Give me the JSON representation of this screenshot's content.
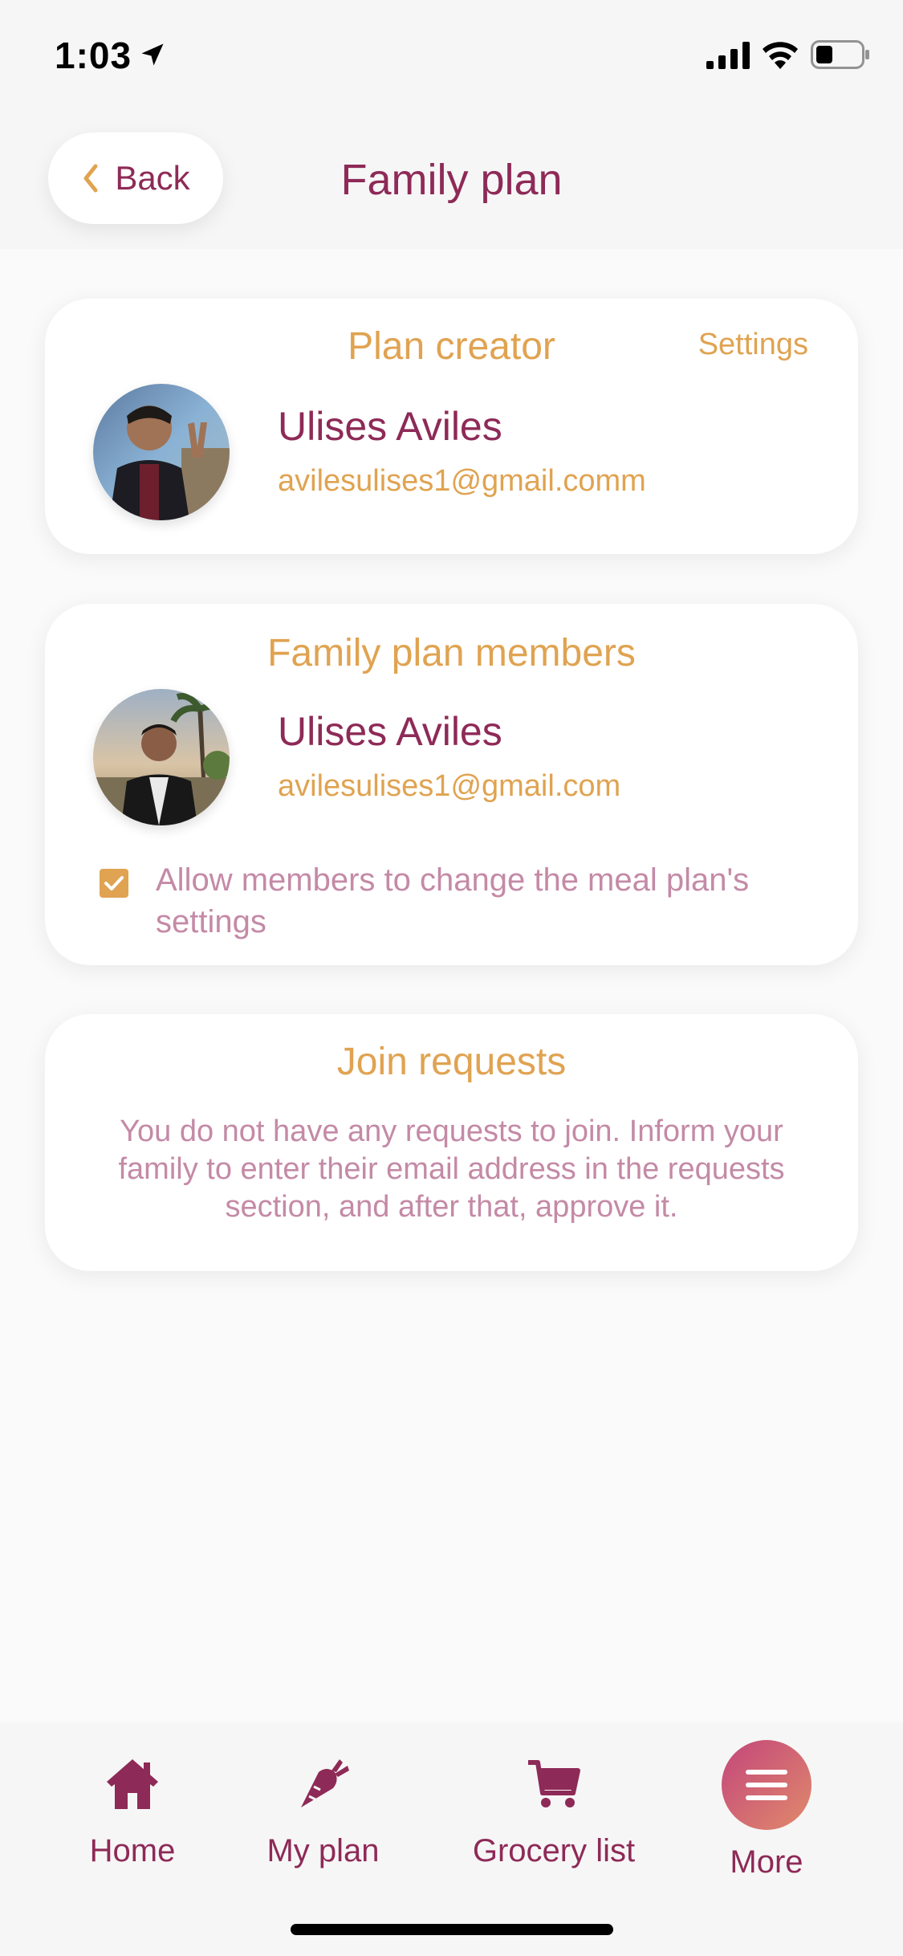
{
  "status_bar": {
    "time": "1:03"
  },
  "header": {
    "back_label": "Back",
    "title": "Family plan"
  },
  "creator_card": {
    "title": "Plan creator",
    "settings_label": "Settings",
    "name": "Ulises Aviles",
    "email": "avilesulises1@gmail.comm"
  },
  "members_card": {
    "title": "Family plan members",
    "name": "Ulises Aviles",
    "email": "avilesulises1@gmail.com",
    "checkbox_label": "Allow members to change the meal plan's settings",
    "checkbox_checked": true
  },
  "requests_card": {
    "title": "Join requests",
    "message": "You do not have any requests to join. Inform your family to enter their email address in the requests section, and after that, approve it."
  },
  "bottom_nav": {
    "items": [
      {
        "label": "Home",
        "icon": "home-icon"
      },
      {
        "label": "My plan",
        "icon": "carrot-icon"
      },
      {
        "label": "Grocery list",
        "icon": "cart-icon"
      },
      {
        "label": "More",
        "icon": "menu-icon"
      }
    ]
  },
  "colors": {
    "primary": "#8e2a57",
    "accent": "#e0a351",
    "muted_text": "#c48aa6",
    "more_gradient_start": "#c3467b",
    "more_gradient_end": "#e08a6b"
  }
}
